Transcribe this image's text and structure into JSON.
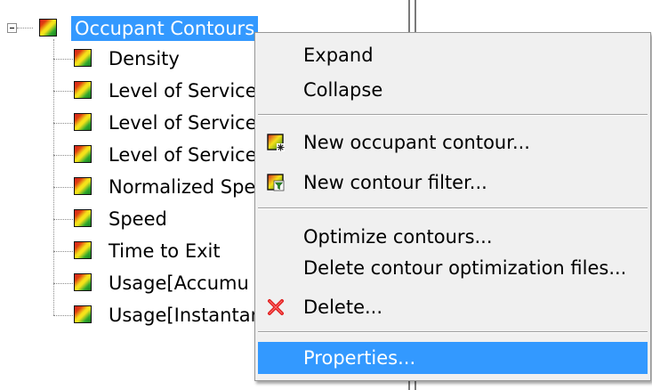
{
  "tree": {
    "root": {
      "label": "Occupant Contours",
      "icon": "contour-gradient-icon",
      "expanded": true
    },
    "children": [
      {
        "label": "Density"
      },
      {
        "label": "Level of Service"
      },
      {
        "label": "Level of Service"
      },
      {
        "label": "Level of Service"
      },
      {
        "label": "Normalized Spe"
      },
      {
        "label": "Speed"
      },
      {
        "label": "Time to Exit"
      },
      {
        "label": "Usage[Accumu"
      },
      {
        "label": "Usage[Instantar"
      }
    ]
  },
  "context_menu": {
    "items": [
      {
        "label": "Expand"
      },
      {
        "label": "Collapse"
      },
      {
        "label": "New occupant contour...",
        "icon": "new-contour-icon"
      },
      {
        "label": "New contour filter...",
        "icon": "contour-filter-icon"
      },
      {
        "label": "Optimize contours..."
      },
      {
        "label": "Delete contour optimization files..."
      },
      {
        "label": "Delete...",
        "icon": "delete-x-icon"
      },
      {
        "label": "Properties...",
        "selected": true
      }
    ]
  },
  "colors": {
    "selection": "#3399ff",
    "menu_background": "#f0f0f0",
    "delete_icon": "#e02020"
  }
}
